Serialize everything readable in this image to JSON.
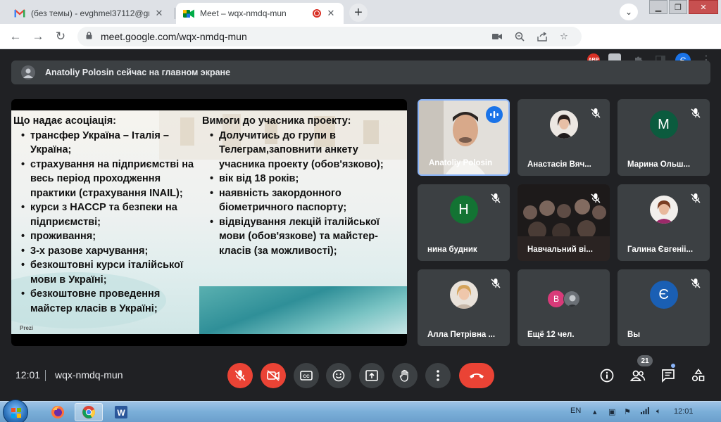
{
  "browser": {
    "tabs": [
      {
        "title": "(без темы) - evghmel37112@gm",
        "icon": "gmail-icon"
      },
      {
        "title": "Meet – wqx-nmdq-mun",
        "icon": "meet-icon",
        "recording": true
      }
    ],
    "url": "meet.google.com/wqx-nmdq-mun",
    "profile_initial": "Є",
    "abp_label": "ABP"
  },
  "meet": {
    "banner": "Anatoliy Polosin сейчас на главном экране",
    "slide": {
      "col1_heading": "Що надає асоціація:",
      "col1_items": [
        "трансфер Україна – Італія – Україна;",
        "страхування на підприємстві на весь період проходження практики (страхування INAIL);",
        "курси з HACCP та безпеки на підприємстві;",
        "проживання;",
        "3-х разове харчування;",
        "безкоштовні курси італійської мови в Україні;",
        "безкоштовне проведення майстер класів в Україні;"
      ],
      "col2_heading": "Вимоги до учасника проекту:",
      "col2_items": [
        "Долучитись до групи в Телеграм,заповнити анкету учасника проекту (обов'язково);",
        "вік від 18 років;",
        "наявність закордонного біометричного паспорту;",
        "відвідування лекцій італійської мови (обов'язкове)  та майстер-класів (за можливості);"
      ],
      "watermark": "Prezi"
    },
    "participants": [
      {
        "name": "Anatoliy Polosin",
        "type": "video",
        "speaking": true
      },
      {
        "name": "Анастасія Вяч...",
        "type": "photo",
        "muted": true
      },
      {
        "name": "Марина Ольш...",
        "type": "letter",
        "initial": "М",
        "color": "#0b5b3e",
        "muted": true
      },
      {
        "name": "нина будник",
        "type": "letter",
        "initial": "Н",
        "color": "#137333",
        "muted": true
      },
      {
        "name": "Навчальний ві...",
        "type": "video-group",
        "muted": true
      },
      {
        "name": "Галина Євгеніі...",
        "type": "photo",
        "muted": true
      },
      {
        "name": "Алла Петрівна ...",
        "type": "photo",
        "muted": true
      },
      {
        "name": "Ещё 12 чел.",
        "type": "more",
        "initial": "В"
      },
      {
        "name": "Вы",
        "type": "letter",
        "initial": "Є",
        "color": "#1a5fb4",
        "muted": true
      }
    ],
    "time": "12:01",
    "meeting_code": "wqx-nmdq-mun",
    "participant_count": "21"
  },
  "taskbar": {
    "lang": "EN",
    "time": "12:01",
    "apps": [
      "firefox-icon",
      "chrome-icon",
      "word-icon"
    ]
  }
}
